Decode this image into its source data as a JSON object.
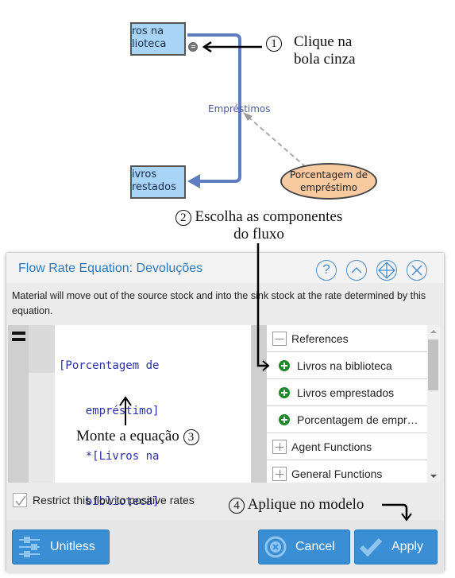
{
  "diagram": {
    "stock_top": {
      "line1": "ros na",
      "line2": "lioteca"
    },
    "stock_bottom": {
      "line1": "ivros",
      "line2": "restados"
    },
    "flow_label": "Empréstimos",
    "variable": {
      "line1": "Porcentagem de",
      "line2": "empréstimo"
    },
    "colors": {
      "stock_fill": "#a8d4f5",
      "flow_pipe": "#5f7ec0",
      "variable_fill": "#f9c9a0",
      "link_dashed": "#aaaaaa"
    }
  },
  "annotations": {
    "step1": {
      "number": "1",
      "line1": "Clique na",
      "line2": "bola cinza"
    },
    "step2": {
      "number": "2",
      "line1": "Escolha as componentes",
      "line2": "do fluxo"
    },
    "step3": {
      "number": "3",
      "text": "Monte a equação"
    },
    "step4": {
      "number": "4",
      "text": "Aplique no modelo"
    }
  },
  "dialog": {
    "title": "Flow Rate Equation: Devoluções",
    "header_buttons": [
      {
        "name": "help",
        "icon": "question-icon"
      },
      {
        "name": "collapse",
        "icon": "chevron-up-icon"
      },
      {
        "name": "move",
        "icon": "move-icon"
      },
      {
        "name": "close",
        "icon": "close-icon"
      }
    ],
    "description": "Material will move out of the source stock and into the sink stock at the rate determined by this equation.",
    "equation_lines": [
      "[Porcentagem de",
      "    empréstimo]",
      "    *[Livros na",
      "    biblioteca]"
    ],
    "references_panel": {
      "sections": [
        {
          "label": "References",
          "expanded": true
        },
        {
          "label": "Agent Functions",
          "expanded": false
        },
        {
          "label": "General Functions",
          "expanded": false
        }
      ],
      "references": [
        "Livros na biblioteca",
        "Livros emprestados",
        "Porcentagem de empr…"
      ]
    },
    "restrict_checkbox": {
      "label": "Restrict this flow to positive rates",
      "checked": true
    },
    "buttons": {
      "unitless": "Unitless",
      "cancel": "Cancel",
      "apply": "Apply"
    },
    "colors": {
      "accent": "#2a7ac0",
      "button": "#3a8fd4",
      "add_icon": "#1e8a2a"
    }
  }
}
